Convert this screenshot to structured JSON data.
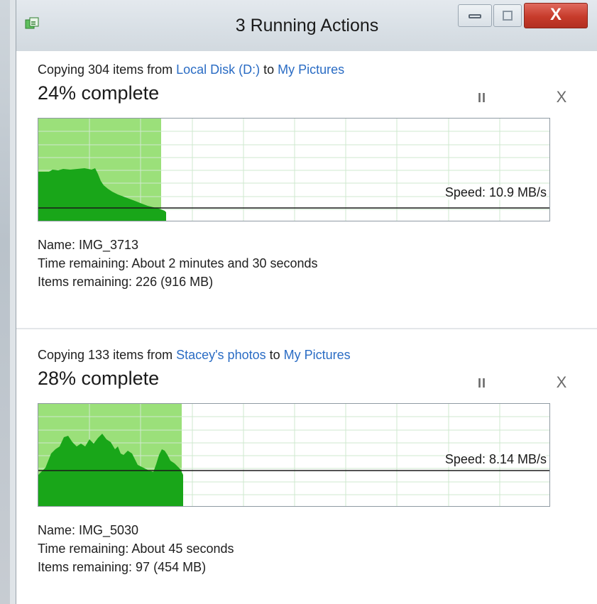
{
  "window": {
    "title": "3 Running Actions",
    "close_label": "X"
  },
  "colors": {
    "progress_fill": "#9be07a",
    "speed_fill": "#19a619",
    "grid": "#cfe9cf",
    "link": "#2a6cc4",
    "close_button": "#c73b2b"
  },
  "actions": [
    {
      "prefix": "Copying 304 items from ",
      "source": "Local Disk (D:)",
      "to": " to ",
      "destination": "My Pictures",
      "percent_text": "24% complete",
      "progress": 0.24,
      "pause_label": "II",
      "cancel_label": "X",
      "speed_text": "Speed: 10.9 MB/s",
      "name_text": "Name: IMG_3713",
      "time_text": "Time remaining: About 2 minutes and 30 seconds",
      "items_text": "Items remaining: 226 (916 MB)"
    },
    {
      "prefix": "Copying 133 items from ",
      "source": "Stacey's photos",
      "to": " to ",
      "destination": "My Pictures",
      "percent_text": "28% complete",
      "progress": 0.28,
      "pause_label": "II",
      "cancel_label": "X",
      "speed_text": "Speed: 8.14 MB/s",
      "name_text": "Name: IMG_5030",
      "time_text": "Time remaining: About 45 seconds",
      "items_text": "Items remaining: 97 (454 MB)"
    }
  ]
}
